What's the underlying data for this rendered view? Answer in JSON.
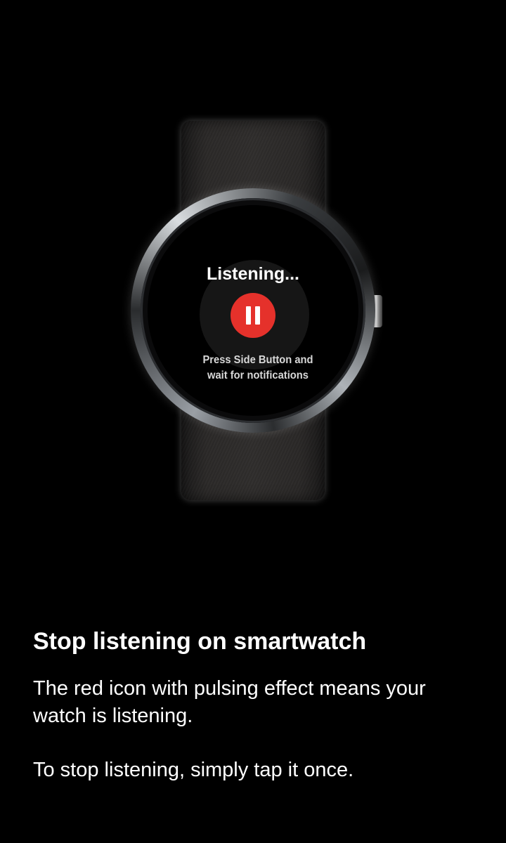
{
  "watch": {
    "screen_title": "Listening...",
    "hint_line_1": "Press Side Button and",
    "hint_line_2": "wait for notifications",
    "button_icon": "pause-icon",
    "button_color": "#e5312b"
  },
  "content": {
    "heading": "Stop listening on smartwatch",
    "paragraph_1": "The red icon with pulsing effect means your watch is listening.",
    "paragraph_2": "To stop listening, simply tap it once."
  }
}
